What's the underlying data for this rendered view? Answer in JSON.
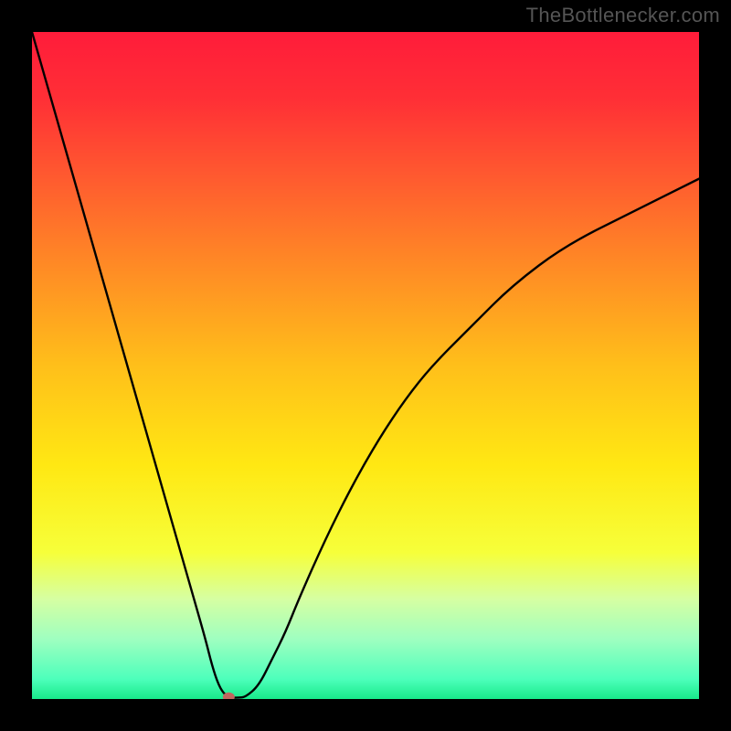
{
  "watermark": "TheBottlenecker.com",
  "chart_data": {
    "type": "line",
    "title": "",
    "xlabel": "",
    "ylabel": "",
    "xlim": [
      0,
      100
    ],
    "ylim": [
      0,
      100
    ],
    "background_gradient": {
      "type": "vertical",
      "stops": [
        {
          "pos": 0.0,
          "color": "#ff1c3a"
        },
        {
          "pos": 0.1,
          "color": "#ff2f36"
        },
        {
          "pos": 0.22,
          "color": "#ff5b2f"
        },
        {
          "pos": 0.35,
          "color": "#ff8a25"
        },
        {
          "pos": 0.5,
          "color": "#ffbf1a"
        },
        {
          "pos": 0.65,
          "color": "#ffe813"
        },
        {
          "pos": 0.78,
          "color": "#f6ff3a"
        },
        {
          "pos": 0.85,
          "color": "#d6ffa2"
        },
        {
          "pos": 0.91,
          "color": "#9fffc0"
        },
        {
          "pos": 0.97,
          "color": "#4dffbb"
        },
        {
          "pos": 1.0,
          "color": "#18ea8a"
        }
      ]
    },
    "series": [
      {
        "name": "bottleneck-curve",
        "color": "#000000",
        "x": [
          0,
          2,
          4,
          6,
          8,
          10,
          12,
          14,
          16,
          18,
          20,
          22,
          24,
          26,
          27,
          28,
          29,
          30,
          31,
          32,
          34,
          36,
          38,
          40,
          44,
          48,
          52,
          56,
          60,
          66,
          72,
          80,
          90,
          100
        ],
        "y": [
          100,
          93,
          86,
          79,
          72,
          65,
          58,
          51,
          44,
          37,
          30,
          23,
          16,
          9,
          5,
          2,
          0.5,
          0.2,
          0.2,
          0.3,
          2,
          6,
          10,
          15,
          24,
          32,
          39,
          45,
          50,
          56,
          62,
          68,
          73,
          78
        ]
      }
    ],
    "marker": {
      "name": "selected-point",
      "x": 29.5,
      "y": 0.3,
      "color": "#c0675f",
      "rx": 6.5,
      "ry": 5
    }
  }
}
